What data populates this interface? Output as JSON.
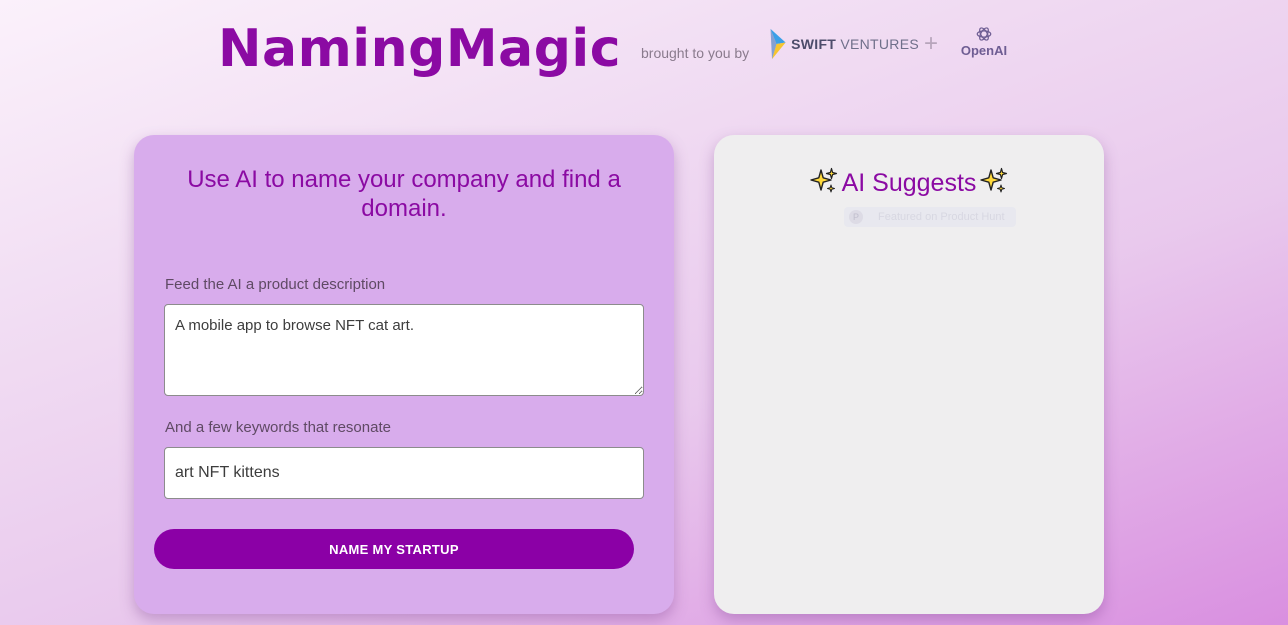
{
  "header": {
    "title": "NamingMagic",
    "byline": "brought to you by",
    "partner_swift_1": "SWIFT",
    "partner_swift_2": "VENTURES",
    "plus": "+",
    "partner_openai": "OpenAI"
  },
  "form": {
    "heading": "Use AI to name your company and find a domain.",
    "description_label": "Feed the AI a product description",
    "description_value": "A mobile app to browse NFT cat art.",
    "keywords_label": "And a few keywords that resonate",
    "keywords_value": "art NFT kittens",
    "submit_label": "NAME MY STARTUP"
  },
  "results": {
    "title": "AI Suggests",
    "badge_text": "Featured on Product Hunt"
  },
  "colors": {
    "brand_purple": "#8b0aa3",
    "button_purple": "#8b00a6",
    "form_card": "#d8acec",
    "results_card": "#efeeef",
    "sparkle_yellow": "#ffd93b"
  },
  "icons": {
    "swift_logo": "swift-ventures-arrow-icon",
    "openai_logo": "openai-knot-icon",
    "sparkle": "sparkles-icon",
    "badge": "product-hunt-icon"
  }
}
